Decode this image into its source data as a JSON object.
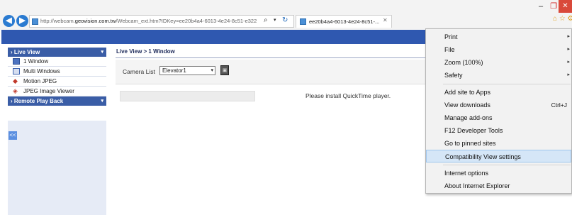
{
  "browser": {
    "window_controls": {
      "minimize": "–",
      "restore": "❐",
      "close": "✕"
    },
    "nav": {
      "back": "◀",
      "forward": "▶"
    },
    "address": {
      "prefix": "http://webcam.",
      "domain": "geovision.com.tw",
      "suffix": "/Webcam_ext.htm?IDKey=ee20b4a4-6013-4e24-8c51-e322",
      "search_icon": "⌕",
      "dropdown_icon": "▾",
      "refresh_icon": "↻"
    },
    "tab": {
      "title": "ee20b4a4-6013-4e24-8c51-...",
      "close": "✕"
    },
    "toolbar_icons": "⌂ ☆ ⚙"
  },
  "sidebar": {
    "sections": [
      {
        "label": "Live View",
        "caret": "▾"
      },
      {
        "label": "Remote Play Back",
        "caret": "▾"
      }
    ],
    "items": [
      {
        "label": "1 Window"
      },
      {
        "label": "Multi Windows"
      },
      {
        "label": "Motion JPEG"
      },
      {
        "label": "JPEG Image Viewer"
      }
    ],
    "collapse_label": "<<"
  },
  "main": {
    "breadcrumb": "Live View > 1 Window",
    "camera_list_label": "Camera List",
    "camera_selected": "Elevator1",
    "select_arrow": "▾",
    "player_message": "Please install QuickTime player."
  },
  "context_menu": {
    "items": [
      {
        "label": "Print",
        "arrow": "▸"
      },
      {
        "label": "File",
        "arrow": "▸"
      },
      {
        "label": "Zoom (100%)",
        "arrow": "▸"
      },
      {
        "label": "Safety",
        "arrow": "▸"
      },
      {
        "label": "Add site to Apps"
      },
      {
        "label": "View downloads",
        "shortcut": "Ctrl+J"
      },
      {
        "label": "Manage add-ons"
      },
      {
        "label": "F12 Developer Tools"
      },
      {
        "label": "Go to pinned sites"
      },
      {
        "label": "Compatibility View settings",
        "highlighted": true
      },
      {
        "label": "Internet options"
      },
      {
        "label": "About Internet Explorer"
      }
    ]
  },
  "colors": {
    "top_bar": "#2f58b0",
    "sidebar_header": "#3a5da6",
    "menu_highlight": "#d5e6f7"
  }
}
